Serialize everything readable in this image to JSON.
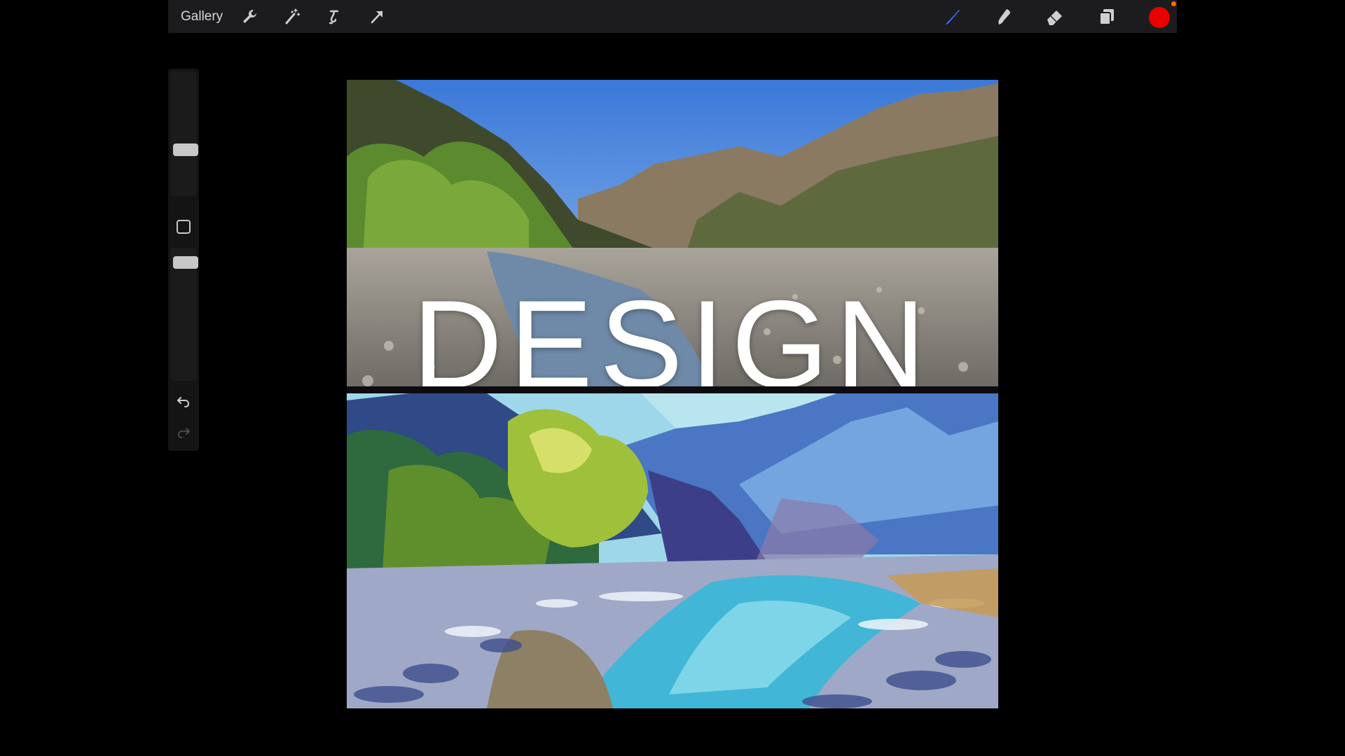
{
  "topbar": {
    "gallery_label": "Gallery",
    "tools_left": [
      "wrench-icon",
      "magic-wand-icon",
      "selection-icon",
      "transform-arrow-icon"
    ],
    "tools_right": [
      "brush-icon",
      "smudge-icon",
      "eraser-icon",
      "layers-icon"
    ],
    "active_color": "#e60000",
    "notification_color": "#ff6a00",
    "active_tool_color": "#2f6bff"
  },
  "sidebar": {
    "brush_size": 0.35,
    "opacity": 0.05,
    "icons": [
      "undo-icon",
      "redo-icon"
    ]
  },
  "canvas": {
    "overlay_text": "DESIGN"
  }
}
